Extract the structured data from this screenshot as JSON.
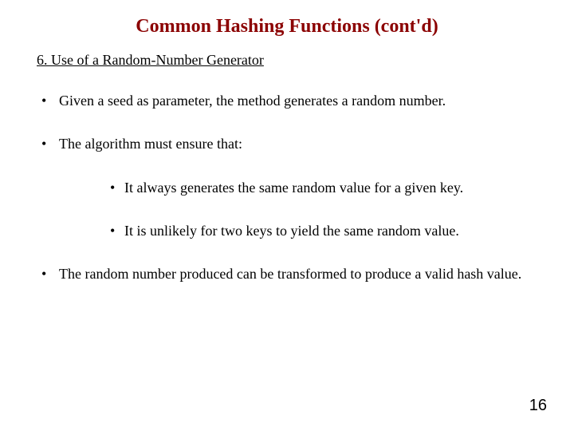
{
  "title": "Common Hashing Functions (cont'd)",
  "section_heading": "6. Use of a Random-Number Generator",
  "bullets": {
    "b1": "Given a seed as parameter, the method generates a random number.",
    "b2": "The algorithm must ensure that:",
    "b2_sub": {
      "s1": "It always generates the same random value for a given key.",
      "s2": "It is unlikely for two keys to yield the same random value."
    },
    "b3": "The random number produced can be transformed to produce a valid hash value."
  },
  "page_number": "16"
}
